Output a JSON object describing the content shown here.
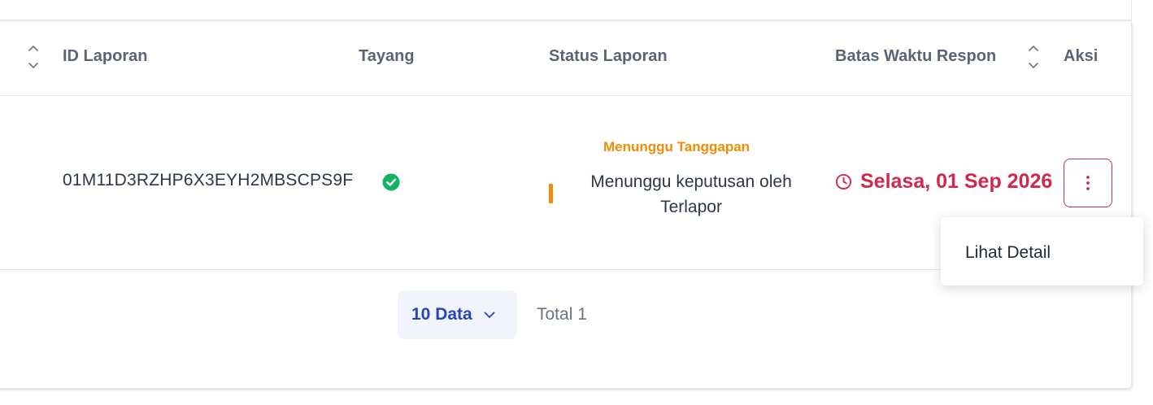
{
  "table": {
    "columns": {
      "id": "ID Laporan",
      "tayang": "Tayang",
      "status": "Status Laporan",
      "deadline": "Batas Waktu Respon",
      "action": "Aksi"
    },
    "rows": [
      {
        "id": "01M11D3RZHP6X3EYH2MBSCPS9F",
        "tayang": true,
        "status_tag": "Menunggu Tanggapan",
        "status_desc": "Menunggu keputusan oleh Terlapor",
        "deadline": "Selasa, 01 Sep 2026"
      }
    ]
  },
  "pagination": {
    "page_size_label": "10 Data",
    "total_label": "Total 1"
  },
  "action_menu": {
    "items": [
      "Lihat Detail"
    ]
  },
  "colors": {
    "status_pending": "#f08c00",
    "deadline": "#d1294b",
    "accent": "#2645b8",
    "success": "#16b364"
  }
}
